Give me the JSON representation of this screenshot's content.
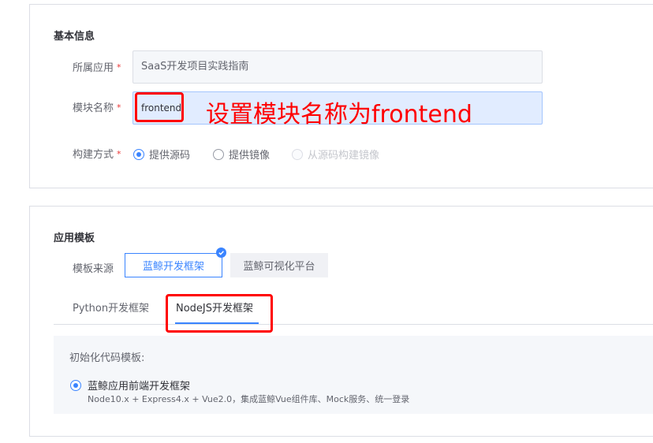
{
  "basic_info": {
    "title": "基本信息",
    "app_label": "所属应用",
    "app_value": "SaaS开发项目实践指南",
    "module_label": "模块名称",
    "module_value": "frontend",
    "build_label": "构建方式",
    "required_mark": "*",
    "build_options": [
      {
        "label": "提供源码",
        "checked": true,
        "disabled": false
      },
      {
        "label": "提供镜像",
        "checked": false,
        "disabled": false
      },
      {
        "label": "从源码构建镜像",
        "checked": false,
        "disabled": true
      }
    ]
  },
  "annotation": {
    "text": "设置模块名称为frontend",
    "color": "#ff0000"
  },
  "app_template": {
    "title": "应用模板",
    "source_label": "模板来源",
    "sources": [
      {
        "label": "蓝鲸开发框架",
        "selected": true
      },
      {
        "label": "蓝鲸可视化平台",
        "selected": false
      }
    ],
    "tabs": [
      {
        "label": "Python开发框架",
        "active": false
      },
      {
        "label": "NodeJS开发框架",
        "active": true
      }
    ],
    "init_title": "初始化代码模板:",
    "init_option": {
      "label": "蓝鲸应用前端开发框架",
      "description": "Node10.x + Express4.x + Vue2.0，集成蓝鲸Vue组件库、Mock服务、统一登录",
      "checked": true
    }
  },
  "colors": {
    "primary": "#3a84ff",
    "required": "#ea3636",
    "highlight": "#ff0000"
  }
}
